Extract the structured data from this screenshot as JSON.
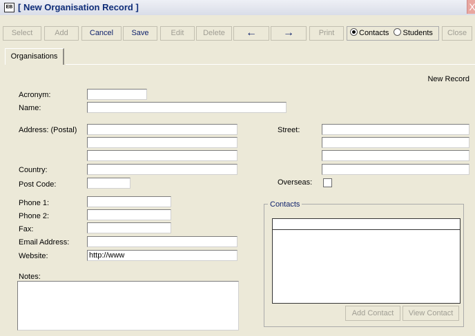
{
  "window": {
    "title": "[ New Organisation Record ]",
    "icon": "form-icon",
    "close_icon": "close-icon",
    "close_glyph": "X"
  },
  "toolbar": {
    "select": "Select",
    "add": "Add",
    "cancel": "Cancel",
    "save": "Save",
    "edit": "Edit",
    "delete": "Delete",
    "prev": "←",
    "next": "→",
    "print": "Print",
    "contacts_radio": "Contacts",
    "students_radio": "Students",
    "selected_radio": "Contacts",
    "close": "Close"
  },
  "tabs": [
    "Organisations"
  ],
  "status": "New Record",
  "form": {
    "acronym": {
      "label": "Acronym:",
      "value": ""
    },
    "name": {
      "label": "Name:",
      "value": ""
    },
    "address": {
      "label": "Address: (Postal)",
      "lines": [
        "",
        "",
        ""
      ]
    },
    "country": {
      "label": "Country:",
      "value": ""
    },
    "post_code": {
      "label": "Post Code:",
      "value": ""
    },
    "street": {
      "label": "Street:",
      "lines": [
        "",
        "",
        "",
        ""
      ]
    },
    "overseas": {
      "label": "Overseas:",
      "checked": false
    },
    "phone1": {
      "label": "Phone 1:",
      "value": ""
    },
    "phone2": {
      "label": "Phone 2:",
      "value": ""
    },
    "fax": {
      "label": "Fax:",
      "value": ""
    },
    "email": {
      "label": "Email Address:",
      "value": ""
    },
    "website": {
      "label": "Website:",
      "value": "http://www"
    },
    "notes": {
      "label": "Notes:",
      "value": ""
    }
  },
  "contacts": {
    "title": "Contacts",
    "items": [],
    "add_button": "Add Contact",
    "view_button": "View Contact"
  },
  "colors": {
    "background": "#ECE9D8",
    "accent": "#0c1f6a",
    "disabled_text": "#9f9d93"
  }
}
